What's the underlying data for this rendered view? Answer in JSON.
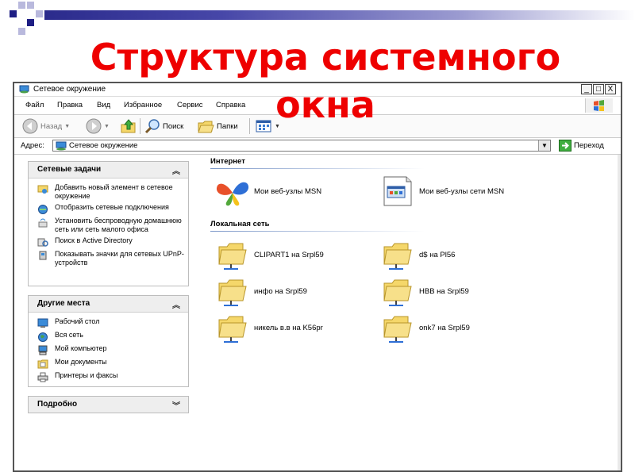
{
  "slide": {
    "title_line1": "Структура системного",
    "title_line2": "окна"
  },
  "window": {
    "title": "Сетевое окружение",
    "buttons": [
      "_",
      "□",
      "X"
    ]
  },
  "menu": [
    "Файл",
    "Правка",
    "Вид",
    "Избранное",
    "Сервис",
    "Справка"
  ],
  "toolbar": {
    "back": "Назад",
    "search": "Поиск",
    "folders": "Папки"
  },
  "address": {
    "label": "Адрес:",
    "value": "Сетевое окружение",
    "go": "Переход"
  },
  "tasks": {
    "network": {
      "title": "Сетевые задачи",
      "items": [
        "Добавить новый элемент в сетевое окружение",
        "Отобразить сетевые подключения",
        "Установить беспроводную домашнюю сеть или сеть малого офиса",
        "Поиск в Active Directory",
        "Показывать значки для сетевых UPnP-устройств"
      ]
    },
    "places": {
      "title": "Другие места",
      "items": [
        "Рабочий стол",
        "Вся сеть",
        "Мой компьютер",
        "Мои документы",
        "Принтеры и факсы"
      ]
    },
    "details": {
      "title": "Подробно"
    }
  },
  "groups": {
    "internet": {
      "title": "Интернет",
      "items": [
        "Мои веб-узлы MSN",
        "Мои веб-узлы сети MSN"
      ]
    },
    "local": {
      "title": "Локальная сеть",
      "items": [
        "CLIPART1 на Srpl59",
        "d$ на Pl56",
        "инфо на Srpl59",
        "HBB на Srpl59",
        "никель в.в на K56pr",
        "onk7 на Srpl59"
      ]
    }
  },
  "colors": {
    "title_red": "#ee0000",
    "deco_blue": "#2b2b8c",
    "folder_yellow": "#f5d76a"
  }
}
